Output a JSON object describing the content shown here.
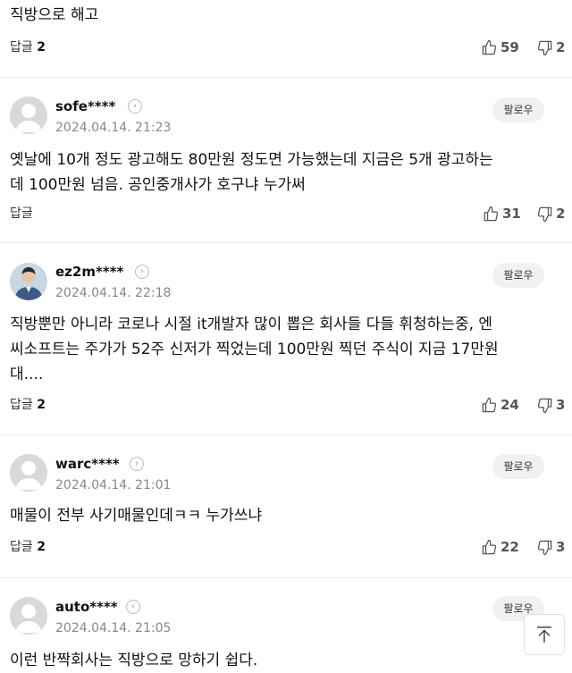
{
  "partial": {
    "text": "직방으로 해고",
    "reply_label": "답글",
    "reply_count": "2",
    "likes": "59",
    "dislikes": "2"
  },
  "follow_label": "팔로우",
  "reply_label": "답글",
  "comments": [
    {
      "username": "sofe****",
      "date": "2024.04.14. 21:23",
      "lines": [
        "옛날에 10개 정도 광고해도 80만원 정도면 가능했는데 지금은 5개 광고하는",
        "데 100만원 넘음. 공인중개사가 호구냐 누가써"
      ],
      "reply_count": "",
      "likes": "31",
      "dislikes": "2"
    },
    {
      "username": "ez2m****",
      "date": "2024.04.14. 22:18",
      "lines": [
        "직방뿐만 아니라 코로나 시절 it개발자 많이 뽑은 회사들 다들 휘청하는중, 엔",
        "씨소프트는 주가가 52주 신저가 찍었는데 100만원 찍던 주식이 지금 17만원",
        "대...."
      ],
      "reply_count": "2",
      "likes": "24",
      "dislikes": "3"
    },
    {
      "username": "warc****",
      "date": "2024.04.14. 21:01",
      "lines": [
        "매물이 전부 사기매물인데ㅋㅋ 누가쓰냐"
      ],
      "reply_count": "2",
      "likes": "22",
      "dislikes": "3"
    },
    {
      "username": "auto****",
      "date": "2024.04.14. 21:05",
      "lines": [
        "이런 반짝회사는 직방으로 망하기 쉽다."
      ],
      "reply_count": "",
      "likes": "",
      "dislikes": ""
    }
  ],
  "icons": {
    "like": "thumbs-up-icon",
    "dislike": "thumbs-down-icon",
    "chevron": "chevron-right-icon",
    "scroll_top": "arrow-up-to-top-icon"
  }
}
